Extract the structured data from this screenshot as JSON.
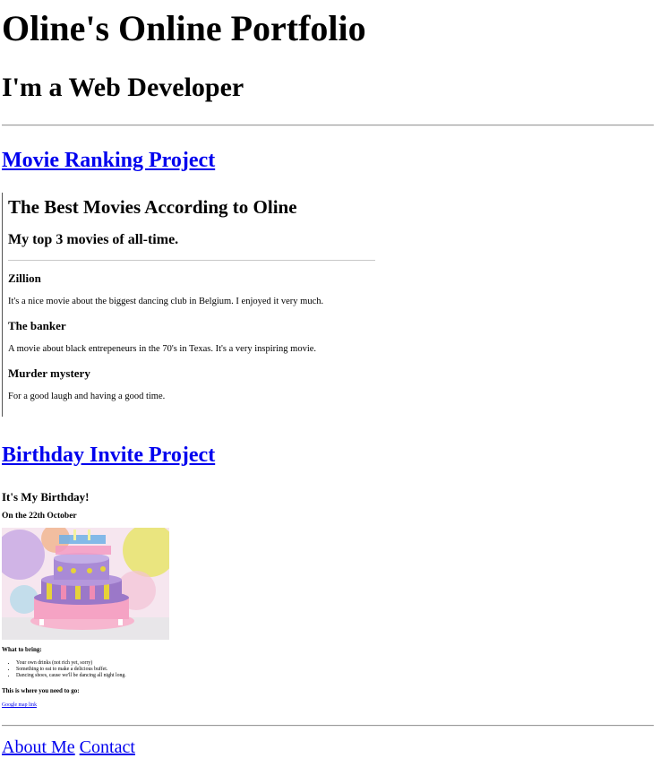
{
  "header": {
    "title": "Oline's Online Portfolio",
    "subtitle": "I'm a Web Developer"
  },
  "projects": {
    "movie_link": "Movie Ranking Project",
    "birthday_link": "Birthday Invite Project"
  },
  "movies": {
    "heading": "The Best Movies According to Oline",
    "subheading": "My top 3 movies of all-time.",
    "items": [
      {
        "title": "Zillion",
        "description": "It's a nice movie about the biggest dancing club in Belgium. I enjoyed it very much."
      },
      {
        "title": "The banker",
        "description": "A movie about black entrepeneurs in the 70's in Texas. It's a very inspiring movie."
      },
      {
        "title": "Murder mystery",
        "description": "For a good laugh and having a good time."
      }
    ]
  },
  "birthday": {
    "heading": "It's My Birthday!",
    "date": "On the 22th October",
    "image_text": "HAPPY BIRTHDAY",
    "bring_heading": "What to bring:",
    "bring_items": [
      "Your own drinks (not rich yet, sorry)",
      "Something to eat to make a delicious buffet.",
      "Dancing shoes, cause we'll be dancing all night long."
    ],
    "where_heading": "This is where you need to go:",
    "map_link": "Google map link"
  },
  "footer": {
    "about": "About Me",
    "contact": "Contact"
  }
}
